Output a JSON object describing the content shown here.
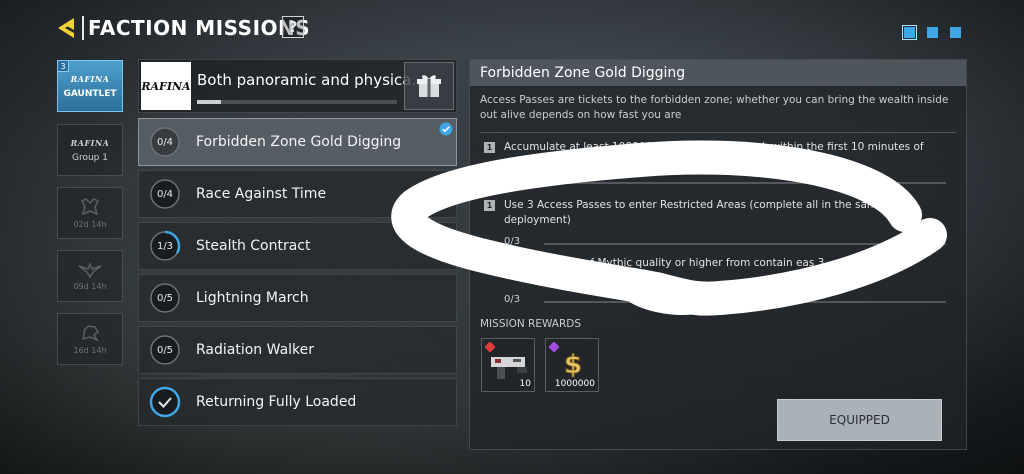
{
  "header": {
    "title": "FACTION MISSIONS",
    "help": "?"
  },
  "pager": {
    "count": 3,
    "active_index": 0
  },
  "faction_tabs": [
    {
      "badge": "3",
      "logo": "RAFINA",
      "label": "GAUNTLET",
      "state": "active"
    },
    {
      "logo": "RAFINA",
      "label": "Group 1",
      "state": "inactive"
    },
    {
      "label": "02d 14h",
      "state": "locked"
    },
    {
      "label": "09d 14h",
      "state": "locked"
    },
    {
      "label": "16d 14h",
      "state": "locked"
    }
  ],
  "featured": {
    "logo": "RAFINA",
    "title": "Both panoramic and physica...",
    "progress": 0.12
  },
  "missions": [
    {
      "progress": "0/4",
      "name": "Forbidden Zone Gold Digging",
      "fraction": 0,
      "selected": true,
      "tracked": true
    },
    {
      "progress": "0/4",
      "name": "Race Against Time",
      "fraction": 0,
      "selected": false,
      "tracked": true
    },
    {
      "progress": "1/3",
      "name": "Stealth Contract",
      "fraction": 0.333,
      "selected": false,
      "tracked": false
    },
    {
      "progress": "0/5",
      "name": "Lightning March",
      "fraction": 0,
      "selected": false,
      "tracked": false
    },
    {
      "progress": "0/5",
      "name": "Radiation Walker",
      "fraction": 0,
      "selected": false,
      "tracked": false
    },
    {
      "progress": "",
      "name": "Returning Fully Loaded",
      "fraction": 1,
      "selected": false,
      "tracked": false,
      "completed": true
    }
  ],
  "detail": {
    "title": "Forbidden Zone Gold Digging",
    "description": "Access Passes are tickets to the forbidden zone; whether you can bring the wealth inside out alive depends on how fast you are",
    "tasks": [
      {
        "num": "1",
        "text": "Accumulate at least 100000 Cash in the backpack within the first 10 minutes of any",
        "progress": ""
      },
      {
        "num": "1",
        "text": "Use 3 Access Passes to enter Restricted Areas (complete all in the same deployment)",
        "progress": "0/3"
      },
      {
        "num": "",
        "text": "of Mythic quality or higher from contain                                          eas 3",
        "progress": "0/3"
      }
    ],
    "rewards_label": "MISSION REWARDS",
    "rewards": [
      {
        "qty": "10",
        "icon": "gun-reward-icon",
        "tag_color": "#e23b3b"
      },
      {
        "qty": "1000000",
        "icon": "cash-reward-icon",
        "tag_color": "#a24ce0"
      }
    ],
    "equip_label": "EQUIPPED"
  },
  "colors": {
    "accent_blue": "#3fa7e6",
    "logo_yellow": "#f2d23a"
  }
}
